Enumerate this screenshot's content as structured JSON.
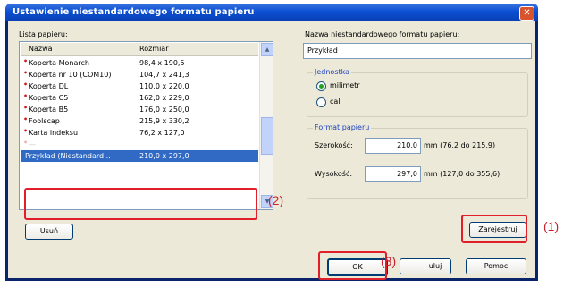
{
  "dialog": {
    "title": "Ustawienie niestandardowego formatu papieru",
    "close_glyph": "✕"
  },
  "paper_list": {
    "label": "Lista papieru:",
    "columns": [
      "Nazwa",
      "Rozmiar"
    ],
    "rows": [
      {
        "name": "Koperta Monarch",
        "size": "98,4 x 190,5"
      },
      {
        "name": "Koperta nr 10 (COM10)",
        "size": "104,7 x 241,3"
      },
      {
        "name": "Koperta DL",
        "size": "110,0 x 220,0"
      },
      {
        "name": "Koperta C5",
        "size": "162,0 x 229,0"
      },
      {
        "name": "Koperta B5",
        "size": "176,0 x 250,0"
      },
      {
        "name": "Foolscap",
        "size": "215,9 x 330,2"
      },
      {
        "name": "Karta indeksu",
        "size": "76,2 x 127,0"
      },
      {
        "name": "Przykład (Niestandard...",
        "size": "210,0 x 297,0"
      }
    ],
    "selected_index": 7
  },
  "delete_button": "Usuń",
  "custom_name": {
    "label": "Nazwa niestandardowego formatu papieru:",
    "value": "Przykład"
  },
  "units": {
    "title": "Jednostka",
    "options": [
      "milimetr",
      "cal"
    ],
    "selected": "milimetr"
  },
  "format": {
    "title": "Format papieru",
    "width_label": "Szerokość:",
    "width_value": "210,0",
    "width_range": "mm (76,2 do 215,9)",
    "height_label": "Wysokość:",
    "height_value": "297,0",
    "height_range": "mm (127,0 do 355,6)"
  },
  "register_button": "Zarejestruj",
  "ok_button": "OK",
  "cancel_button": "Anuluj",
  "cancel_visible": "uluj",
  "help_button": "Pomoc",
  "callouts": [
    "(1)",
    "(2)",
    "(3)"
  ],
  "colors": {
    "accent": "#e01f2b",
    "selection": "#316ac5",
    "title_bar": "#0b4fd2"
  }
}
